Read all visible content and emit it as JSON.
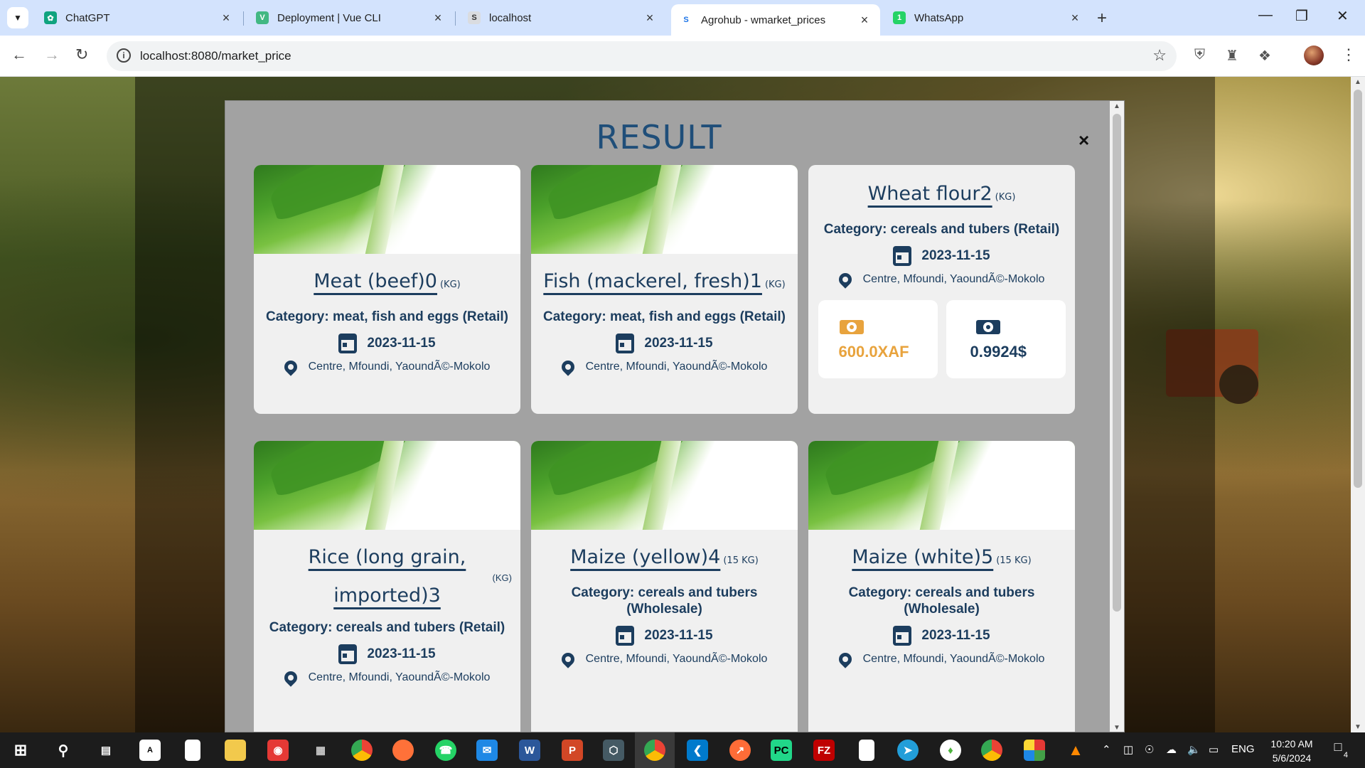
{
  "browser": {
    "tabs": [
      {
        "title": "ChatGPT",
        "favicon": "chatgpt-icon",
        "color": "#10a37f"
      },
      {
        "title": "Deployment | Vue CLI",
        "favicon": "vue-icon",
        "color": "#42b883"
      },
      {
        "title": "localhost",
        "favicon": "site-icon",
        "color": "#5f6368"
      },
      {
        "title": "Agrohub - wmarket_prices",
        "favicon": "agrohub-icon",
        "color": "#1a73e8"
      },
      {
        "title": "WhatsApp",
        "favicon": "whatsapp-icon",
        "color": "#25d366"
      }
    ],
    "active_tab_index": 3,
    "url": "localhost:8080/market_price"
  },
  "modal": {
    "title": "RESULT",
    "close_label": "×"
  },
  "cards": [
    {
      "name": "Meat (beef)0",
      "unit": "(KG)",
      "category": "Category: meat, fish and eggs (Retail)",
      "date": "2023-11-15",
      "location": "Centre, Mfoundi, YaoundÃ©-Mokolo"
    },
    {
      "name": "Fish (mackerel, fresh)1",
      "unit": "(KG)",
      "category": "Category: meat, fish and eggs (Retail)",
      "date": "2023-11-15",
      "location": "Centre, Mfoundi, YaoundÃ©-Mokolo"
    },
    {
      "name": "Wheat flour2",
      "unit": "(KG)",
      "category": "Category: cereals and tubers (Retail)",
      "date": "2023-11-15",
      "location": "Centre, Mfoundi, YaoundÃ©-Mokolo",
      "price_local": "600.0XAF",
      "price_usd": "0.9924$"
    },
    {
      "name": "Rice (long grain, imported)3",
      "unit": "(KG)",
      "category": "Category: cereals and tubers (Retail)",
      "date": "2023-11-15",
      "location": "Centre, Mfoundi, YaoundÃ©-Mokolo"
    },
    {
      "name": "Maize (yellow)4",
      "unit": "(15 KG)",
      "category": "Category: cereals and tubers (Wholesale)",
      "date": "2023-11-15",
      "location": "Centre, Mfoundi, YaoundÃ©-Mokolo"
    },
    {
      "name": "Maize (white)5",
      "unit": "(15 KG)",
      "category": "Category: cereals and tubers (Wholesale)",
      "date": "2023-11-15",
      "location": "Centre, Mfoundi, YaoundÃ©-Mokolo"
    }
  ],
  "colors": {
    "accent": "#1c3d5e",
    "price_local": "#e8a33d",
    "price_usd": "#1c3d5e"
  },
  "taskbar": {
    "language": "ENG",
    "time": "10:20 AM",
    "date": "5/6/2024",
    "notifications": "4"
  }
}
